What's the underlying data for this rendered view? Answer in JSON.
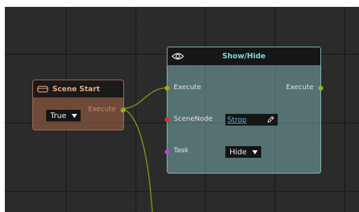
{
  "scene_start": {
    "title": "Scene Start",
    "icon": "vr-headset-icon",
    "dropdown_value": "True",
    "output_label": "Execute",
    "header_color": "#e8a585"
  },
  "show_hide": {
    "title": "Show/Hide",
    "icon": "eye-icon",
    "input_execute_label": "Execute",
    "output_execute_label": "Execute",
    "scene_node_label": "SceneNode",
    "scene_node_value": "Strop",
    "task_label": "Task",
    "task_value": "Hide",
    "header_color": "#7fd8dc"
  },
  "colors": {
    "wire": "#8a8a10",
    "exec_pin": "#9ab020",
    "scene_node_pin": "#e03030",
    "task_pin": "#c040d0"
  }
}
